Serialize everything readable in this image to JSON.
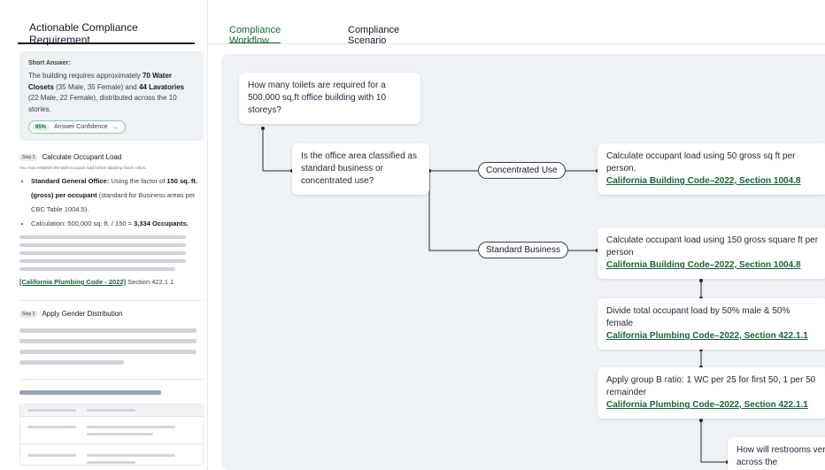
{
  "left": {
    "tab_label": "Actionable Compliance Requirement",
    "short_answer": {
      "title": "Short Answer:",
      "t1": "The building requires approximately ",
      "b1": "70 Water Closets",
      "t2": " (35 Male, 35 Female) and ",
      "b2": "44 Lavatories",
      "t3": " (22 Male, 22 Female), distributed across the 10 stories.",
      "confidence_pct": "95%",
      "confidence_label": "Answer Confidence",
      "confidence_arrow": "→"
    },
    "step1": {
      "badge": "Step 1",
      "title": "Calculate Occupant Load",
      "note": "You must establish the total occupant load before applying fixture ratios.",
      "item1_bold": "Standard General Office:",
      "item1_text_a": " Using the factor of ",
      "item1_bold2": "150 sq. ft. (gross) per occupant",
      "item1_text_b": " (standard for Business areas per CBC Table 1004.5).",
      "item2_text": "Calculation: 500,000 sq. ft. / 150 = ",
      "item2_bold": "3,334 Occupants.",
      "cite_link": "[California Plumbing Code - 2022]",
      "cite_rest": " Section 422.1.1"
    },
    "step2": {
      "badge": "Step 2",
      "title": "Apply Gender Distribution"
    }
  },
  "tabs": {
    "workflow": "Compliance Workflow",
    "scenario": "Compliance Scenario"
  },
  "flow": {
    "question": "How many toilets are required for a 500,000 sq,ft office building with 10 storeys?",
    "decision": "Is the office area classified as standard business or concentrated use?",
    "branch_concentrated": "Concentrated Use",
    "branch_standard": "Standard Business",
    "node_concentrated_text": "Calculate occupant load using 50 gross sq ft per person.",
    "node_concentrated_link": "California Building Code–2022, Section 1004.8",
    "node_standard_text": "Calculate occupant load using 150 gross square ft per person",
    "node_standard_link": "California Building Code–2022, Section 1004.8",
    "node_divide_text": "Divide total occupant load by 50% male & 50% female",
    "node_divide_link": "California Plumbing Code–2022, Section 422.1.1",
    "node_ratio_text": "Apply group B ratio: 1 WC per 25 for first 50, 1 per 50 remainder",
    "node_ratio_link": "California Plumbing Code–2022, Section 422.1.1",
    "node_restroom_text": "How will restrooms vertically across the"
  },
  "colors": {
    "accent_green": "#166534",
    "canvas_bg": "#eef2f4"
  }
}
